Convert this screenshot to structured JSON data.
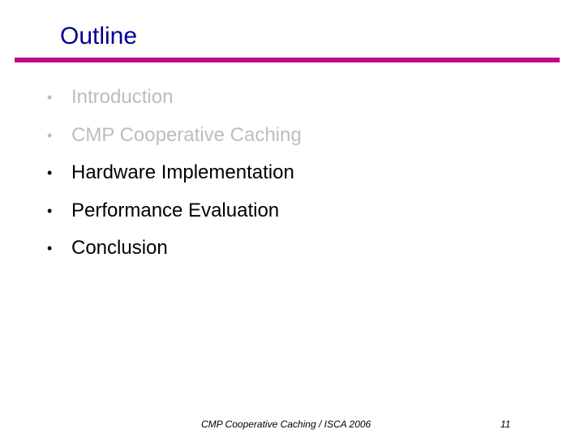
{
  "slide": {
    "title": "Outline",
    "accent_color": "#c0068c",
    "title_color": "#00008f",
    "bullets": [
      {
        "text": "Introduction",
        "state": "dimmed"
      },
      {
        "text": "CMP Cooperative Caching",
        "state": "dimmed"
      },
      {
        "text": "Hardware Implementation",
        "state": "active"
      },
      {
        "text": "Performance Evaluation",
        "state": "active"
      },
      {
        "text": "Conclusion",
        "state": "active"
      }
    ],
    "bullet_glyph": "•",
    "footer": "CMP Cooperative Caching / ISCA 2006",
    "page_number": "11"
  }
}
